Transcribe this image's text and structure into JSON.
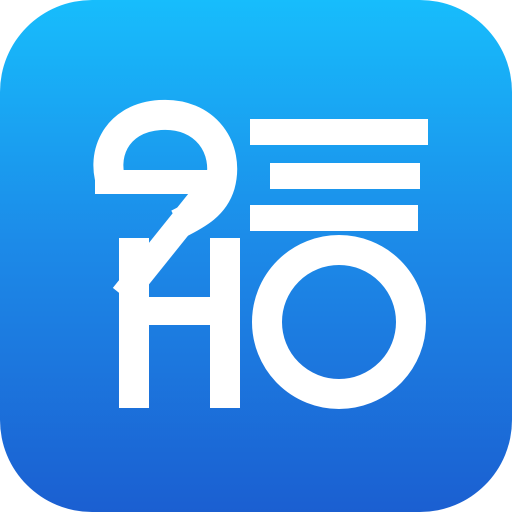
{
  "icon": {
    "name": "app-logo",
    "glyph": "logo-mark-icon",
    "logo_lettering": "2 4 0"
  },
  "colors": {
    "gradient_top": "#17bdfc",
    "gradient_middle": "#1c8ae8",
    "gradient_bottom": "#1b5fd1",
    "glyph": "#ffffff"
  }
}
